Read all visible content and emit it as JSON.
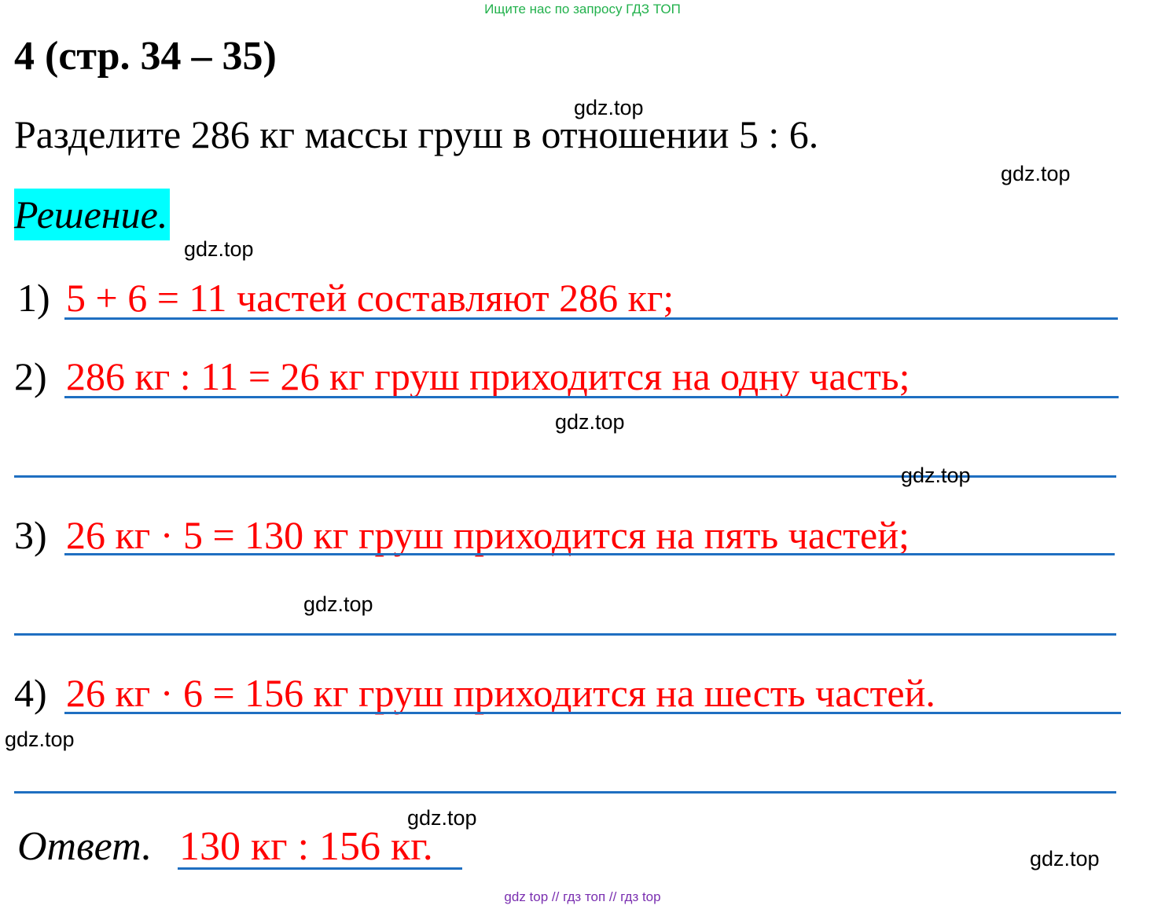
{
  "header": {
    "search_note": "Ищите нас по запросу ГДЗ ТОП"
  },
  "task": {
    "title": "4 (стр. 34 – 35)",
    "problem": "Разделите 286 кг массы груш в отношении 5 : 6."
  },
  "solution": {
    "label": "Решение.",
    "steps": [
      {
        "number": "1)",
        "text": "5 + 6 = 11 частей составляют 286 кг;"
      },
      {
        "number": "2)",
        "text": "286 кг : 11 = 26 кг груш приходится на одну часть;"
      },
      {
        "number": "3)",
        "text": "26 кг · 5 = 130 кг груш приходится на пять частей;"
      },
      {
        "number": "4)",
        "text": "26 кг · 6 = 156 кг груш приходится на шесть частей."
      }
    ]
  },
  "answer": {
    "label": "Ответ.",
    "text": "130 кг : 156 кг."
  },
  "watermark": "gdz.top",
  "footer": {
    "links": "gdz top  //  гдз топ  //  гдз top"
  },
  "colors": {
    "answer_text": "#ff0000",
    "rule_lines": "#1f6fc1",
    "highlight": "#00ffff",
    "top_note": "#22b14c",
    "bottom_note": "#7a2fb0"
  }
}
